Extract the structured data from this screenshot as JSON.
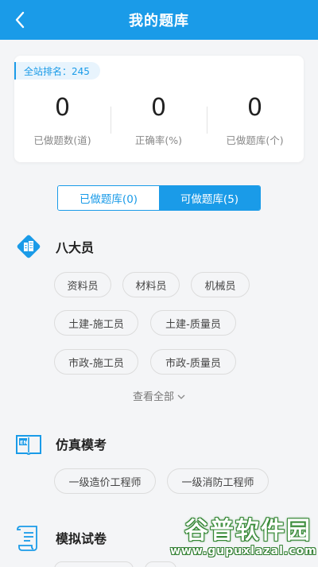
{
  "header": {
    "title": "我的题库",
    "back_icon": "chevron-left-icon"
  },
  "stats": {
    "rank": "全站排名：245",
    "items": [
      {
        "value": "0",
        "label": "已做题数(道)"
      },
      {
        "value": "0",
        "label": "正确率(%)"
      },
      {
        "value": "0",
        "label": "已做题库(个)"
      }
    ]
  },
  "tabs": [
    {
      "label": "已做题库(0)",
      "active": false
    },
    {
      "label": "可做题库(5)",
      "active": true
    }
  ],
  "sections": [
    {
      "title": "八大员",
      "icon": "building-icon",
      "chips": [
        "资料员",
        "材料员",
        "机械员",
        "土建-施工员",
        "土建-质量员",
        "市政-施工员",
        "市政-质量员"
      ]
    },
    {
      "title": "仿真模考",
      "icon": "en-book-icon",
      "chips": [
        "一级造价工程师",
        "一级消防工程师"
      ]
    },
    {
      "title": "模拟试卷",
      "icon": "scroll-icon",
      "chips": []
    }
  ],
  "view_all": "查看全部",
  "watermark": {
    "main": "谷普软件园",
    "sub": "www.gupuxlazal.com"
  },
  "colors": {
    "accent": "#1a9be8",
    "background": "#f4f5f7"
  }
}
